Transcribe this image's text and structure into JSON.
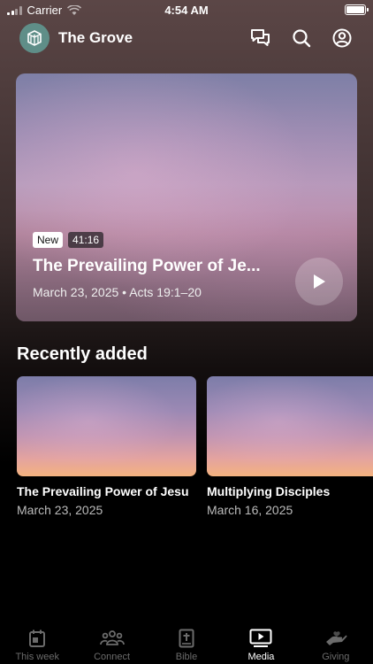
{
  "status_bar": {
    "carrier": "Carrier",
    "time": "4:54 AM"
  },
  "header": {
    "title": "The Grove",
    "icons": [
      "chat-icon",
      "search-icon",
      "account-icon"
    ]
  },
  "featured": {
    "badge_new": "New",
    "duration": "41:16",
    "title": "The Prevailing Power of Je...",
    "meta": "March 23, 2025 • Acts 19:1–20"
  },
  "recently_added": {
    "heading": "Recently added",
    "items": [
      {
        "title": "The Prevailing Power of Jesu",
        "date": "March 23, 2025"
      },
      {
        "title": "Multiplying Disciples",
        "date": "March 16, 2025"
      }
    ]
  },
  "tab_bar": {
    "active_tab": "Media",
    "tabs": [
      {
        "label": "This week",
        "icon": "calendar-icon"
      },
      {
        "label": "Connect",
        "icon": "people-icon"
      },
      {
        "label": "Bible",
        "icon": "bible-icon"
      },
      {
        "label": "Media",
        "icon": "media-play-icon"
      },
      {
        "label": "Giving",
        "icon": "giving-hand-icon"
      }
    ]
  },
  "colors": {
    "logo_bg": "#5f8e88",
    "active_tab": "#ffffff",
    "inactive_tab": "#6b6b6b"
  }
}
